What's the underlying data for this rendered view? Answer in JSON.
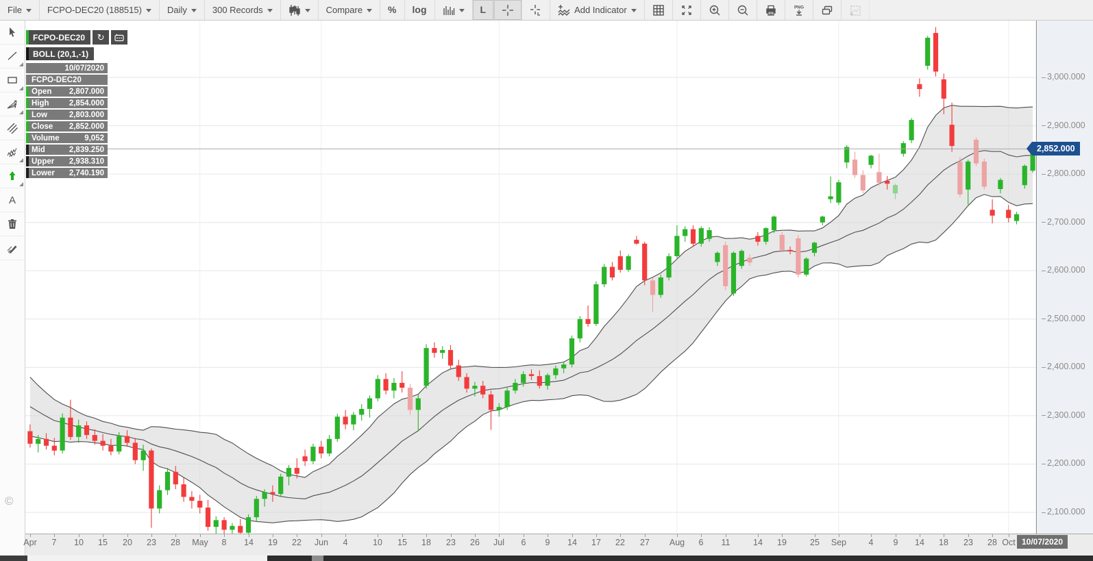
{
  "toolbar": {
    "items": [
      {
        "name": "file-menu",
        "label": "File",
        "caret": true
      },
      {
        "name": "symbol-menu",
        "label": "FCPO-DEC20 (188515)",
        "caret": true
      },
      {
        "name": "period-menu",
        "label": "Daily",
        "caret": true
      },
      {
        "name": "records-menu",
        "label": "300 Records",
        "caret": true
      },
      {
        "name": "chart-type-menu",
        "icon": "candles-icon",
        "caret": true
      },
      {
        "name": "compare-menu",
        "label": "Compare",
        "caret": true
      },
      {
        "name": "percent-scale-button",
        "label": "%",
        "bold": true
      },
      {
        "name": "log-scale-button",
        "label": "log",
        "bold": true
      },
      {
        "name": "volume-style-menu",
        "icon": "histogram-icon",
        "caret": true
      },
      {
        "name": "line-mode-button",
        "label": "L",
        "bold": true,
        "active": true
      },
      {
        "name": "crosshair-button",
        "icon": "crosshair-icon",
        "active": true
      },
      {
        "name": "crosshair-label-button",
        "icon": "crosshair-l-icon"
      },
      {
        "name": "add-indicator-menu",
        "icon": "add-indicator-icon",
        "label": "Add Indicator",
        "caret": true
      },
      {
        "name": "grid-button",
        "icon": "grid-icon"
      },
      {
        "name": "fullscreen-button",
        "icon": "expand-icon"
      },
      {
        "name": "zoom-in-button",
        "icon": "zoom-in-icon"
      },
      {
        "name": "zoom-out-button",
        "icon": "zoom-out-icon"
      },
      {
        "name": "print-button",
        "icon": "print-icon"
      },
      {
        "name": "png-export-button",
        "icon": "png-download-icon"
      },
      {
        "name": "duplicate-chart-button",
        "icon": "windows-icon"
      },
      {
        "name": "sketch-chart-button",
        "icon": "dotted-chart-icon",
        "disabled": true
      }
    ]
  },
  "tools": [
    {
      "name": "pointer-tool",
      "icon": "pointer-icon"
    },
    {
      "name": "trendline-tool",
      "icon": "line-icon",
      "corner": true
    },
    {
      "name": "rectangle-tool",
      "icon": "rect-icon",
      "corner": true
    },
    {
      "name": "fan-lines-tool",
      "icon": "fan-icon",
      "corner": true
    },
    {
      "name": "parallel-lines-tool",
      "icon": "parallel-icon"
    },
    {
      "name": "freehand-tool",
      "icon": "zigzag-icon",
      "corner": true
    },
    {
      "name": "arrow-marker-tool",
      "icon": "arrow-up-icon",
      "corner": true
    },
    {
      "name": "text-tool",
      "icon": "text-a-icon"
    },
    {
      "name": "delete-tool",
      "icon": "trash-icon"
    },
    {
      "name": "eraser-tool",
      "icon": "pencil-icon"
    }
  ],
  "chips": {
    "symbol": "FCPO-DEC20",
    "boll": "BOLL (20,1,-1)"
  },
  "ohlc_panel": {
    "date": "10/07/2020",
    "symbol": "FCPO-DEC20",
    "rows": [
      {
        "label": "Open",
        "value": "2,807.000",
        "accent": "green"
      },
      {
        "label": "High",
        "value": "2,854.000",
        "accent": "green"
      },
      {
        "label": "Low",
        "value": "2,803.000",
        "accent": "green"
      },
      {
        "label": "Close",
        "value": "2,852.000",
        "accent": "green"
      },
      {
        "label": "Volume",
        "value": "9,052",
        "accent": "green"
      },
      {
        "label": "Mid",
        "value": "2,839.250",
        "accent": "dark"
      },
      {
        "label": "Upper",
        "value": "2,938.310",
        "accent": "dark"
      },
      {
        "label": "Lower",
        "value": "2,740.190",
        "accent": "dark"
      }
    ]
  },
  "footer": {
    "copyright": "©"
  },
  "chart_data": {
    "type": "candlestick",
    "symbol": "FCPO-DEC20",
    "indicator": {
      "name": "BOLL",
      "period": 20,
      "stddev": 1,
      "shift": -1,
      "last_mid": 2839.25,
      "last_upper": 2938.31,
      "last_lower": 2740.19
    },
    "last_price": "2,852.000",
    "last_date": "10/07/2020",
    "ylim": [
      2056,
      3116
    ],
    "y_ticks": [
      {
        "p": 3000,
        "label": "3,000.000"
      },
      {
        "p": 2900,
        "label": "2,900.000"
      },
      {
        "p": 2800,
        "label": "2,800.000"
      },
      {
        "p": 2700,
        "label": "2,700.000"
      },
      {
        "p": 2600,
        "label": "2,600.000"
      },
      {
        "p": 2500,
        "label": "2,500.000"
      },
      {
        "p": 2400,
        "label": "2,400.000"
      },
      {
        "p": 2300,
        "label": "2,300.000"
      },
      {
        "p": 2200,
        "label": "2,200.000"
      },
      {
        "p": 2100,
        "label": "2,100.000"
      }
    ],
    "x_ticks": [
      {
        "i": 0,
        "label": "Apr"
      },
      {
        "i": 3,
        "label": "7"
      },
      {
        "i": 6,
        "label": "10"
      },
      {
        "i": 9,
        "label": "15"
      },
      {
        "i": 12,
        "label": "20"
      },
      {
        "i": 15,
        "label": "23"
      },
      {
        "i": 18,
        "label": "28"
      },
      {
        "i": 21,
        "label": "May"
      },
      {
        "i": 24,
        "label": "8"
      },
      {
        "i": 27,
        "label": "14"
      },
      {
        "i": 30,
        "label": "19"
      },
      {
        "i": 33,
        "label": "22"
      },
      {
        "i": 36,
        "label": "Jun"
      },
      {
        "i": 39,
        "label": "4"
      },
      {
        "i": 43,
        "label": "10"
      },
      {
        "i": 46,
        "label": "15"
      },
      {
        "i": 49,
        "label": "18"
      },
      {
        "i": 52,
        "label": "23"
      },
      {
        "i": 55,
        "label": "26"
      },
      {
        "i": 58,
        "label": "Jul"
      },
      {
        "i": 61,
        "label": "6"
      },
      {
        "i": 64,
        "label": "9"
      },
      {
        "i": 67,
        "label": "14"
      },
      {
        "i": 70,
        "label": "17"
      },
      {
        "i": 73,
        "label": "22"
      },
      {
        "i": 76,
        "label": "27"
      },
      {
        "i": 80,
        "label": "Aug"
      },
      {
        "i": 83,
        "label": "6"
      },
      {
        "i": 86,
        "label": "11"
      },
      {
        "i": 90,
        "label": "14"
      },
      {
        "i": 93,
        "label": "19"
      },
      {
        "i": 97,
        "label": "25"
      },
      {
        "i": 100,
        "label": "Sep"
      },
      {
        "i": 104,
        "label": "4"
      },
      {
        "i": 107,
        "label": "9"
      },
      {
        "i": 110,
        "label": "14"
      },
      {
        "i": 113,
        "label": "18"
      },
      {
        "i": 116,
        "label": "23"
      },
      {
        "i": 119,
        "label": "28"
      },
      {
        "i": 121,
        "label": "Oct"
      }
    ],
    "month_grid_indices": [
      21,
      36,
      58,
      80,
      100,
      121
    ],
    "pre_closes": [
      2455,
      2430,
      2410,
      2380,
      2350,
      2365,
      2340,
      2315,
      2325,
      2300,
      2310,
      2285,
      2295,
      2275,
      2280,
      2262,
      2252,
      2258,
      2248
    ],
    "light_indices": [
      47,
      77,
      86,
      89,
      93,
      95,
      102,
      103,
      105,
      107,
      115,
      117,
      118
    ],
    "candles": [
      [
        2268,
        2282,
        2234,
        2242
      ],
      [
        2242,
        2260,
        2224,
        2252
      ],
      [
        2252,
        2264,
        2230,
        2238
      ],
      [
        2238,
        2254,
        2218,
        2228
      ],
      [
        2228,
        2305,
        2222,
        2296
      ],
      [
        2296,
        2333,
        2250,
        2256
      ],
      [
        2256,
        2292,
        2244,
        2280
      ],
      [
        2280,
        2288,
        2252,
        2260
      ],
      [
        2260,
        2272,
        2240,
        2248
      ],
      [
        2248,
        2262,
        2228,
        2238
      ],
      [
        2238,
        2252,
        2218,
        2226
      ],
      [
        2226,
        2266,
        2220,
        2258
      ],
      [
        2258,
        2270,
        2236,
        2244
      ],
      [
        2244,
        2254,
        2200,
        2208
      ],
      [
        2208,
        2240,
        2186,
        2228
      ],
      [
        2228,
        2232,
        2068,
        2108
      ],
      [
        2108,
        2156,
        2098,
        2146
      ],
      [
        2146,
        2192,
        2136,
        2184
      ],
      [
        2184,
        2196,
        2148,
        2158
      ],
      [
        2158,
        2172,
        2122,
        2132
      ],
      [
        2132,
        2144,
        2108,
        2124
      ],
      [
        2124,
        2136,
        2098,
        2110
      ],
      [
        2110,
        2126,
        2062,
        2070
      ],
      [
        2070,
        2092,
        2052,
        2084
      ],
      [
        2084,
        2090,
        2056,
        2064
      ],
      [
        2064,
        2078,
        2040,
        2072
      ],
      [
        2072,
        2086,
        2048,
        2058
      ],
      [
        2058,
        2096,
        2052,
        2090
      ],
      [
        2090,
        2134,
        2080,
        2128
      ],
      [
        2128,
        2148,
        2112,
        2142
      ],
      [
        2142,
        2156,
        2122,
        2138
      ],
      [
        2138,
        2180,
        2132,
        2174
      ],
      [
        2174,
        2198,
        2156,
        2192
      ],
      [
        2192,
        2212,
        2170,
        2180
      ],
      [
        2216,
        2230,
        2196,
        2206
      ],
      [
        2206,
        2242,
        2200,
        2236
      ],
      [
        2236,
        2248,
        2212,
        2222
      ],
      [
        2222,
        2260,
        2216,
        2252
      ],
      [
        2252,
        2304,
        2246,
        2298
      ],
      [
        2298,
        2312,
        2272,
        2282
      ],
      [
        2282,
        2308,
        2270,
        2302
      ],
      [
        2302,
        2324,
        2290,
        2314
      ],
      [
        2314,
        2342,
        2296,
        2336
      ],
      [
        2336,
        2384,
        2330,
        2376
      ],
      [
        2376,
        2388,
        2344,
        2352
      ],
      [
        2352,
        2378,
        2336,
        2368
      ],
      [
        2368,
        2392,
        2348,
        2358
      ],
      [
        2358,
        2366,
        2302,
        2312
      ],
      [
        2312,
        2344,
        2268,
        2336
      ],
      [
        2362,
        2448,
        2356,
        2440
      ],
      [
        2440,
        2452,
        2420,
        2430
      ],
      [
        2430,
        2444,
        2418,
        2436
      ],
      [
        2436,
        2446,
        2398,
        2404
      ],
      [
        2404,
        2416,
        2372,
        2380
      ],
      [
        2380,
        2388,
        2348,
        2356
      ],
      [
        2356,
        2370,
        2340,
        2362
      ],
      [
        2362,
        2372,
        2336,
        2344
      ],
      [
        2344,
        2352,
        2271,
        2312
      ],
      [
        2312,
        2326,
        2298,
        2318
      ],
      [
        2318,
        2358,
        2312,
        2352
      ],
      [
        2352,
        2376,
        2346,
        2368
      ],
      [
        2368,
        2392,
        2360,
        2386
      ],
      [
        2386,
        2396,
        2374,
        2382
      ],
      [
        2382,
        2394,
        2356,
        2362
      ],
      [
        2362,
        2388,
        2354,
        2384
      ],
      [
        2384,
        2404,
        2376,
        2398
      ],
      [
        2398,
        2410,
        2388,
        2406
      ],
      [
        2406,
        2466,
        2400,
        2460
      ],
      [
        2460,
        2506,
        2452,
        2500
      ],
      [
        2500,
        2528,
        2484,
        2490
      ],
      [
        2490,
        2578,
        2486,
        2572
      ],
      [
        2572,
        2614,
        2566,
        2608
      ],
      [
        2608,
        2618,
        2580,
        2586
      ],
      [
        2630,
        2642,
        2596,
        2602
      ],
      [
        2602,
        2634,
        2598,
        2630
      ],
      [
        2664,
        2672,
        2654,
        2656
      ],
      [
        2656,
        2660,
        2570,
        2580
      ],
      [
        2580,
        2586,
        2515,
        2550
      ],
      [
        2550,
        2592,
        2544,
        2586
      ],
      [
        2586,
        2636,
        2580,
        2630
      ],
      [
        2630,
        2694,
        2626,
        2672
      ],
      [
        2672,
        2692,
        2660,
        2686
      ],
      [
        2686,
        2694,
        2650,
        2656
      ],
      [
        2656,
        2692,
        2650,
        2688
      ],
      [
        2666,
        2690,
        2660,
        2684
      ],
      [
        2618,
        2640,
        2610,
        2637
      ],
      [
        2653,
        2660,
        2560,
        2568
      ],
      [
        2553,
        2640,
        2548,
        2637
      ],
      [
        2610,
        2644,
        2604,
        2641
      ],
      [
        2627,
        2634,
        2610,
        2617
      ],
      [
        2672,
        2680,
        2652,
        2660
      ],
      [
        2660,
        2690,
        2654,
        2688
      ],
      [
        2684,
        2714,
        2678,
        2712
      ],
      [
        2674,
        2680,
        2638,
        2643
      ],
      [
        2643,
        2650,
        2634,
        2640
      ],
      [
        2667,
        2674,
        2586,
        2592
      ],
      [
        2592,
        2628,
        2588,
        2625
      ],
      [
        2637,
        2660,
        2630,
        2658
      ],
      [
        2700,
        2714,
        2694,
        2712
      ],
      [
        2748,
        2795,
        2740,
        2754
      ],
      [
        2741,
        2788,
        2736,
        2783
      ],
      [
        2824,
        2860,
        2812,
        2856
      ],
      [
        2830,
        2846,
        2792,
        2798
      ],
      [
        2798,
        2808,
        2760,
        2766
      ],
      [
        2819,
        2840,
        2812,
        2838
      ],
      [
        2804,
        2842,
        2776,
        2782
      ],
      [
        2786,
        2796,
        2768,
        2780
      ],
      [
        2760,
        2780,
        2748,
        2777
      ],
      [
        2842,
        2868,
        2836,
        2864
      ],
      [
        2870,
        2916,
        2864,
        2912
      ],
      [
        2986,
        2998,
        2960,
        2976
      ],
      [
        3024,
        3086,
        3016,
        3082
      ],
      [
        3092,
        3104,
        3002,
        3012
      ],
      [
        2996,
        3008,
        2924,
        2956
      ],
      [
        2902,
        2948,
        2846,
        2858
      ],
      [
        2826,
        2836,
        2752,
        2758
      ],
      [
        2768,
        2830,
        2737,
        2826
      ],
      [
        2871,
        2876,
        2816,
        2822
      ],
      [
        2826,
        2832,
        2768,
        2774
      ],
      [
        2726,
        2748,
        2698,
        2714
      ],
      [
        2769,
        2792,
        2760,
        2788
      ],
      [
        2726,
        2736,
        2700,
        2709
      ],
      [
        2703,
        2722,
        2696,
        2717
      ],
      [
        2777,
        2820,
        2770,
        2817
      ],
      [
        2807,
        2854,
        2803,
        2852
      ]
    ],
    "colors": {
      "up": "#2ab42a",
      "down": "#f23c3c",
      "up_light": "#8ed38e",
      "down_light": "#eda3a3",
      "band_line": "#4d4d4d",
      "band_fill": "#d2d2d2",
      "grid": "#e4e6ea",
      "price_badge": "#1d5091",
      "date_badge": "#6f6f6f"
    }
  }
}
